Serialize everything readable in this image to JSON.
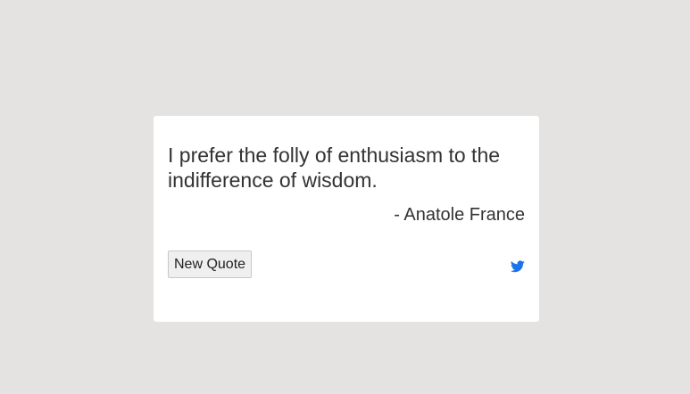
{
  "quote": {
    "text": "I prefer the folly of enthusiasm to the indifference of wisdom.",
    "author": "- Anatole France"
  },
  "actions": {
    "new_quote_label": "New Quote",
    "tweet_icon": "twitter-icon"
  },
  "colors": {
    "background": "#e4e3e1",
    "card": "#ffffff",
    "text": "#333333",
    "twitter_blue": "#1a73e8"
  }
}
